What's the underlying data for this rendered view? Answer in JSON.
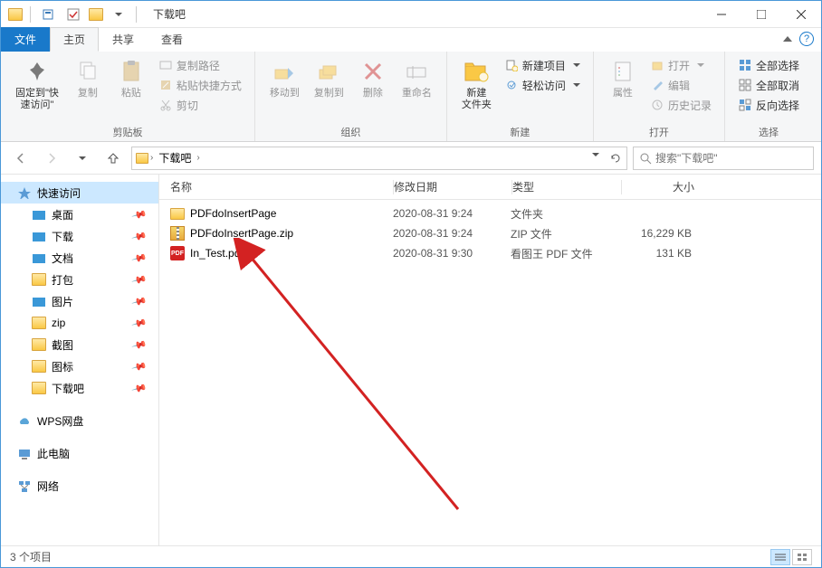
{
  "window": {
    "title": "下载吧"
  },
  "tabs": {
    "file": "文件",
    "home": "主页",
    "share": "共享",
    "view": "查看"
  },
  "ribbon": {
    "pin": "固定到\"快\n速访问\"",
    "copy": "复制",
    "paste": "粘贴",
    "copypath": "复制路径",
    "pasteshortcut": "粘贴快捷方式",
    "cut": "剪切",
    "group_clipboard": "剪贴板",
    "moveto": "移动到",
    "copyto": "复制到",
    "delete": "删除",
    "rename": "重命名",
    "group_org": "组织",
    "newfolder": "新建\n文件夹",
    "newitem": "新建项目",
    "easyaccess": "轻松访问",
    "group_new": "新建",
    "properties": "属性",
    "open": "打开",
    "edit": "编辑",
    "history": "历史记录",
    "group_open": "打开",
    "selectall": "全部选择",
    "selectnone": "全部取消",
    "invert": "反向选择",
    "group_select": "选择"
  },
  "breadcrumb": {
    "root": "下载吧"
  },
  "search": {
    "placeholder": "搜索\"下载吧\""
  },
  "sidebar": {
    "quickaccess": "快速访问",
    "items": [
      {
        "label": "桌面",
        "color": "#3a98d8"
      },
      {
        "label": "下载",
        "color": "#3a98d8"
      },
      {
        "label": "文档",
        "color": "#3a98d8"
      },
      {
        "label": "打包",
        "color": "#fac845"
      },
      {
        "label": "图片",
        "color": "#3a98d8"
      },
      {
        "label": "zip",
        "color": "#fac845"
      },
      {
        "label": "截图",
        "color": "#fac845"
      },
      {
        "label": "图标",
        "color": "#fac845"
      },
      {
        "label": "下载吧",
        "color": "#fac845"
      }
    ],
    "wps": "WPS网盘",
    "thispc": "此电脑",
    "network": "网络"
  },
  "columns": {
    "name": "名称",
    "date": "修改日期",
    "type": "类型",
    "size": "大小"
  },
  "files": [
    {
      "name": "PDFdoInsertPage",
      "date": "2020-08-31 9:24",
      "type": "文件夹",
      "size": "",
      "icon": "folder"
    },
    {
      "name": "PDFdoInsertPage.zip",
      "date": "2020-08-31 9:24",
      "type": "ZIP 文件",
      "size": "16,229 KB",
      "icon": "zip"
    },
    {
      "name": "In_Test.pdf",
      "date": "2020-08-31 9:30",
      "type": "看图王 PDF 文件",
      "size": "131 KB",
      "icon": "pdf"
    }
  ],
  "status": {
    "count": "3 个项目"
  }
}
